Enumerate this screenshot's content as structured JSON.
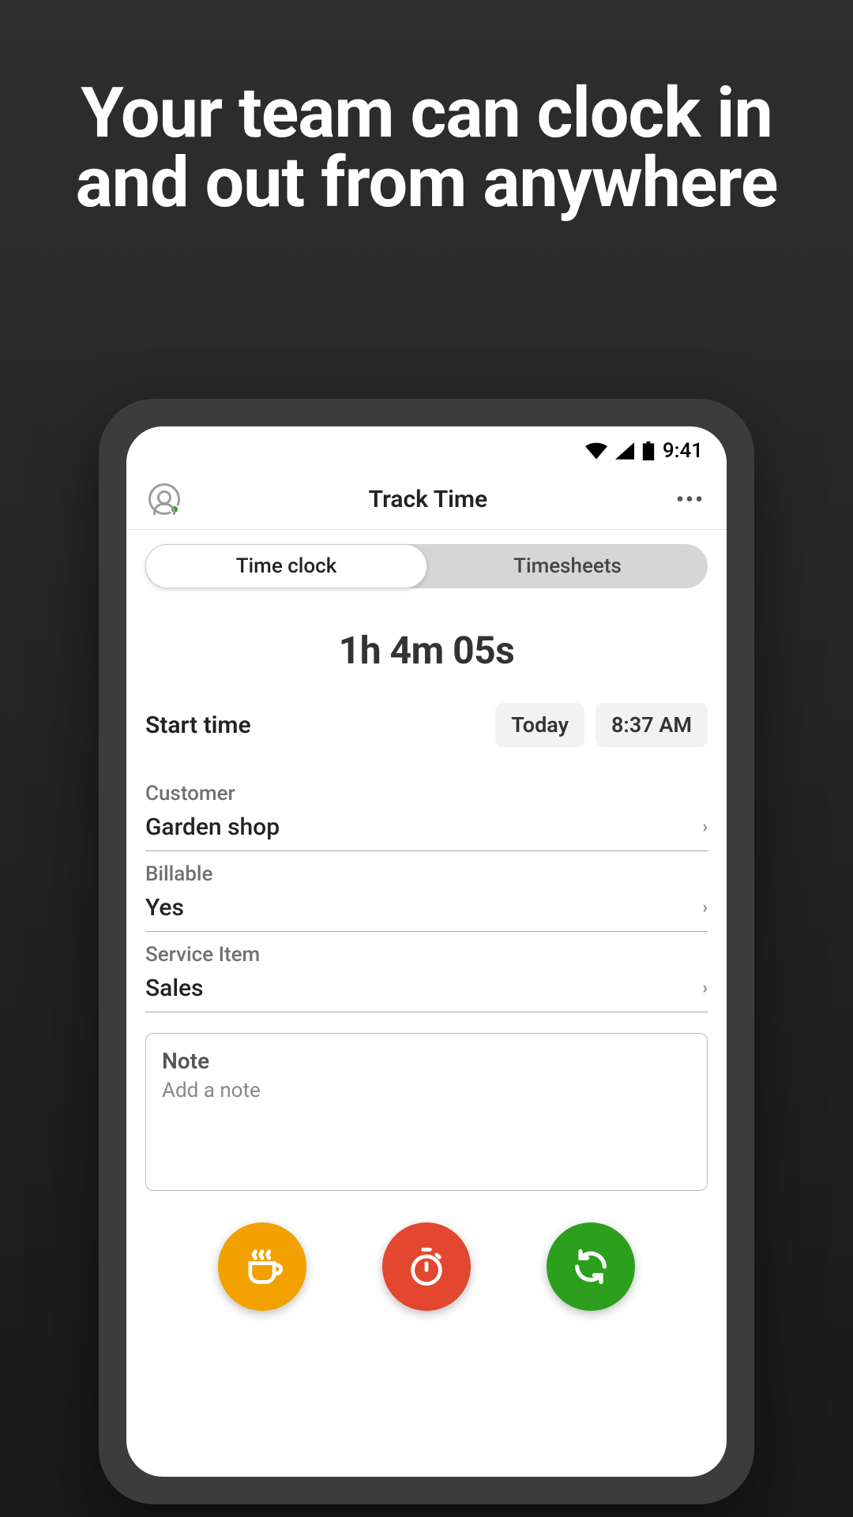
{
  "headline": "Your team can clock in and out from anywhere",
  "status_bar": {
    "time": "9:41"
  },
  "header": {
    "title": "Track Time"
  },
  "tabs": {
    "time_clock": "Time clock",
    "timesheets": "Timesheets"
  },
  "elapsed": "1h 4m 05s",
  "start": {
    "label": "Start time",
    "date": "Today",
    "time": "8:37 AM"
  },
  "fields": {
    "customer": {
      "label": "Customer",
      "value": "Garden shop"
    },
    "billable": {
      "label": "Billable",
      "value": "Yes"
    },
    "service_item": {
      "label": "Service Item",
      "value": "Sales"
    }
  },
  "note": {
    "title": "Note",
    "placeholder": "Add a note"
  },
  "icons": {
    "profile": "profile-icon",
    "more": "more-icon",
    "break": "coffee-icon",
    "stop": "stopwatch-icon",
    "switch": "sync-icon"
  }
}
